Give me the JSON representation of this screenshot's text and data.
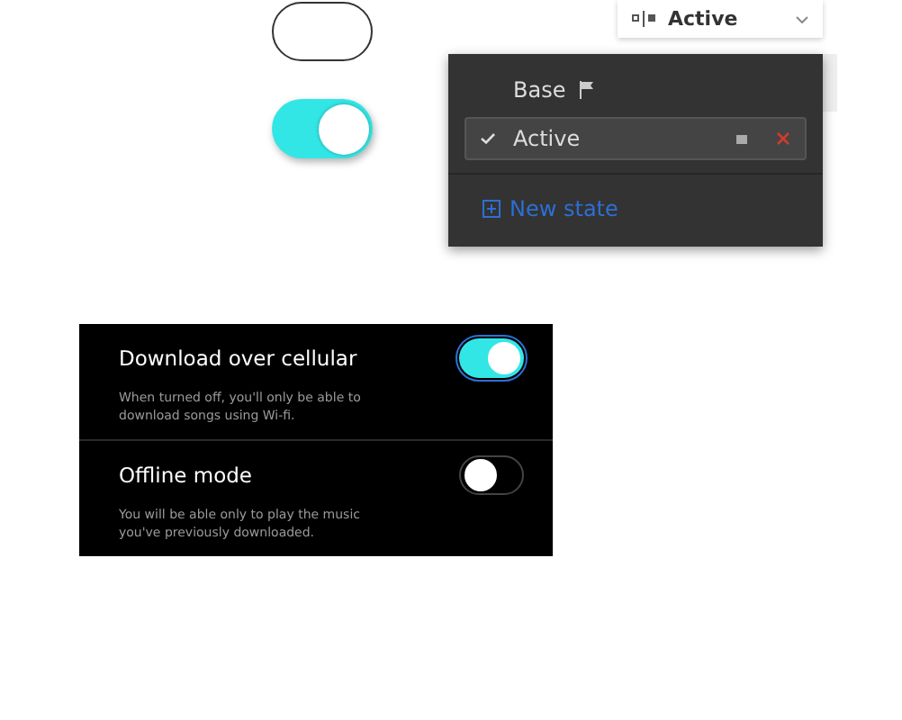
{
  "canvas_toggles": [
    {
      "on": false
    },
    {
      "on": true
    }
  ],
  "state_dropdown": {
    "value": "Active"
  },
  "states_menu": {
    "items": [
      {
        "label": "Base",
        "selected": false,
        "kind": "base"
      },
      {
        "label": "Active",
        "selected": true,
        "kind": "custom"
      }
    ],
    "new_state": "New state"
  },
  "settings": [
    {
      "title": "Download over cellular",
      "description": "When turned off, you'll only be able to download songs using Wi-fi.",
      "on": true,
      "focused": true
    },
    {
      "title": "Offline mode",
      "description": "You will be able only to play the music you've previously downloaded.",
      "on": false,
      "focused": false
    }
  ]
}
